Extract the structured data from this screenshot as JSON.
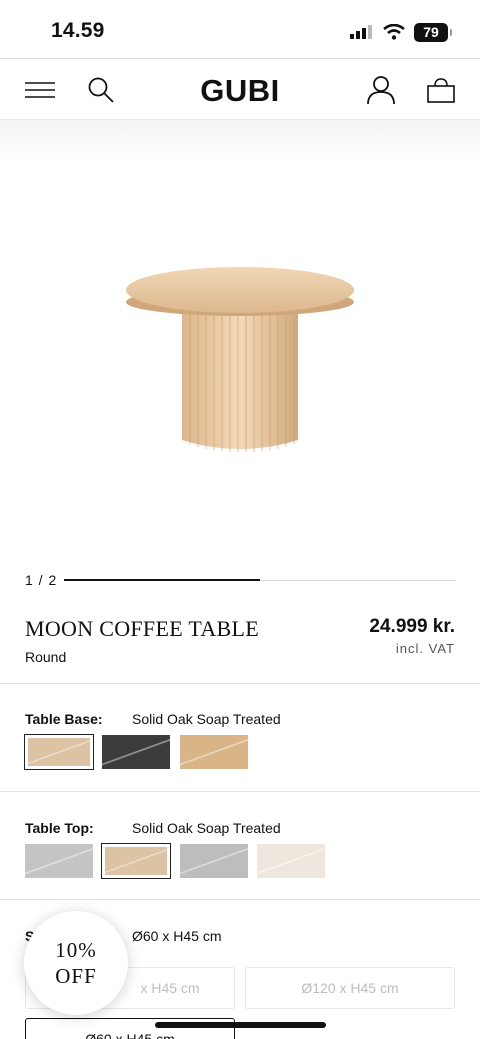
{
  "status_bar": {
    "time": "14.59",
    "battery": "79"
  },
  "header": {
    "logo": "GUBI"
  },
  "carousel": {
    "page_indicator": "1 / 2",
    "progress": 0.5
  },
  "product": {
    "title": "MOON COFFEE TABLE",
    "variant": "Round",
    "price": "24.999 kr.",
    "price_note": "incl. VAT"
  },
  "table_base": {
    "label": "Table Base:",
    "value": "Solid Oak Soap Treated",
    "swatches": [
      {
        "name": "light-oak",
        "color": "#dcc3a4",
        "selected": true
      },
      {
        "name": "dark-stone",
        "color": "#3b3b3b",
        "selected": false
      },
      {
        "name": "oak",
        "color": "#d8b486",
        "selected": false
      }
    ]
  },
  "table_top": {
    "label": "Table Top:",
    "value": "Solid Oak Soap Treated",
    "swatches": [
      {
        "name": "grey-marble",
        "color": "#c4c4c4",
        "selected": false
      },
      {
        "name": "light-oak",
        "color": "#dcc3a4",
        "selected": true
      },
      {
        "name": "grey-stone",
        "color": "#bdbdbd",
        "selected": false
      },
      {
        "name": "white-travertine",
        "color": "#efe7dd",
        "selected": false
      }
    ]
  },
  "size": {
    "label_partial": "S",
    "value": "Ø60 x H45 cm",
    "options": [
      "x H45 cm",
      "Ø120 x H45 cm",
      "Ø60 x H45 cm"
    ]
  },
  "discount": {
    "line1": "10%",
    "line2": "OFF"
  }
}
